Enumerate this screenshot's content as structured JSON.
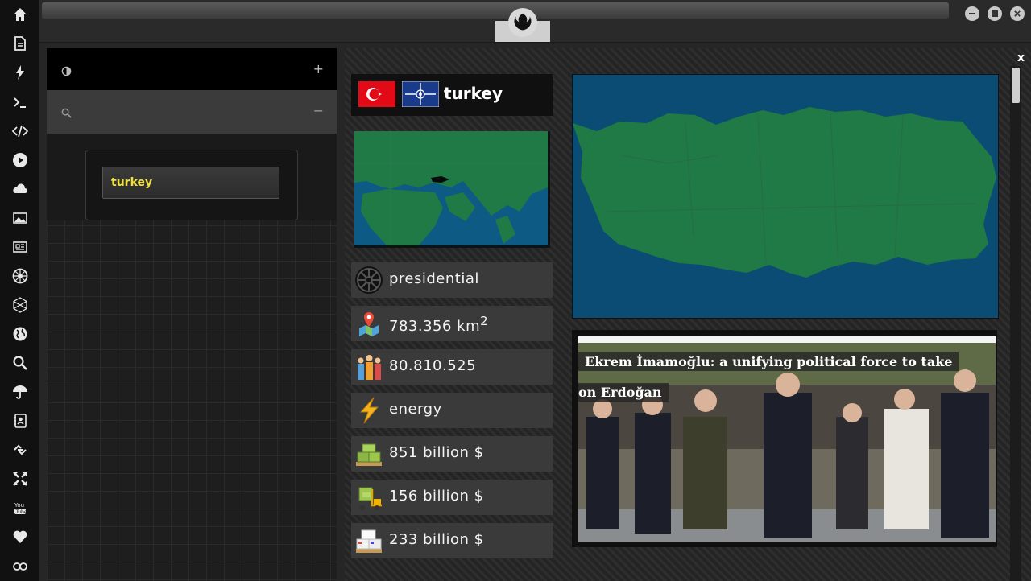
{
  "search": {
    "value": "turkey"
  },
  "leftpanel": {
    "head_toggle_icon": "contrast-icon",
    "plus_label": "+",
    "minus_label": "−"
  },
  "country": {
    "name": "turkey",
    "flag_icon": "turkey-flag-icon",
    "alliance_icon": "nato-flag-icon"
  },
  "stats": [
    {
      "icon": "imperial-emblem-icon",
      "label": "presidential"
    },
    {
      "icon": "map-pin-icon",
      "label": "783.356 km",
      "sup": "2"
    },
    {
      "icon": "population-icon",
      "label": "80.810.525"
    },
    {
      "icon": "lightning-icon",
      "label": "energy"
    },
    {
      "icon": "money-stack-icon",
      "label": "851 billion $"
    },
    {
      "icon": "forklift-money-icon",
      "label": "156 billion $"
    },
    {
      "icon": "boxes-icon",
      "label": "233 billion $"
    }
  ],
  "news": {
    "headline_line1": "Ekrem İmamoğlu: a unifying political force to take",
    "headline_line2": "on Erdoğan"
  },
  "main": {
    "close_label": "x"
  },
  "colors": {
    "accent_text": "#f1e23a",
    "map_land": "#1f7a45",
    "map_sea": "#0b4c74"
  }
}
